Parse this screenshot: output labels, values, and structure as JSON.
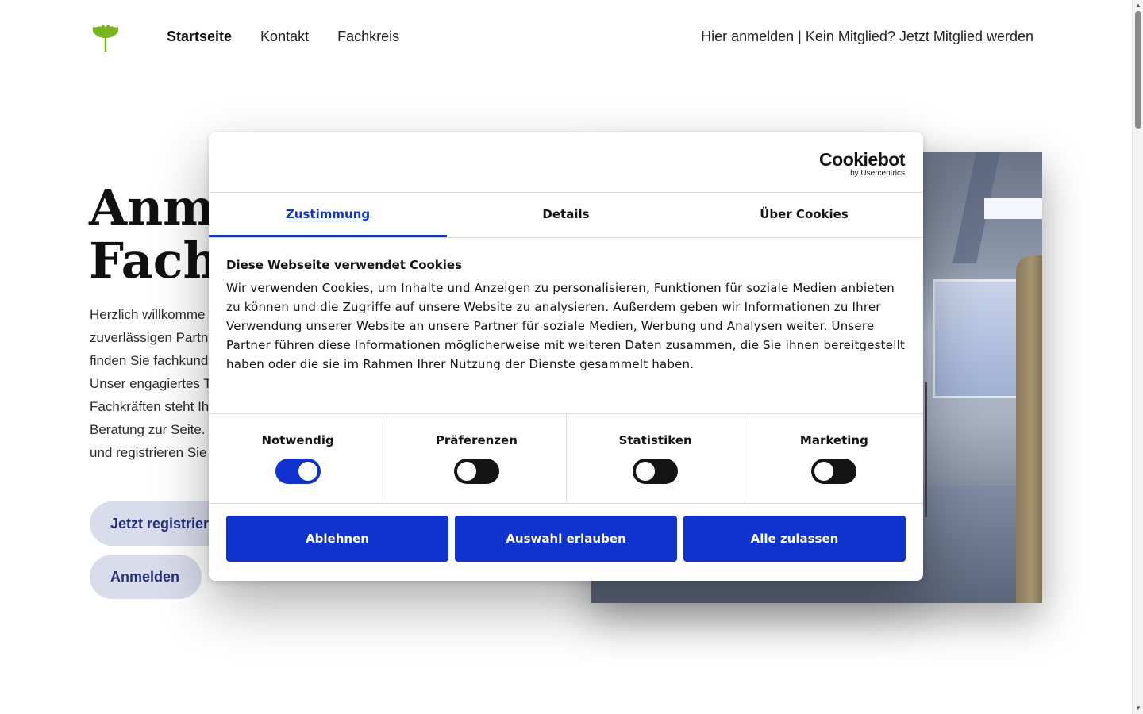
{
  "nav": {
    "items": [
      {
        "label": "Startseite",
        "active": true
      },
      {
        "label": "Kontakt",
        "active": false
      },
      {
        "label": "Fachkreis",
        "active": false
      }
    ],
    "auth": {
      "login": "Hier anmelden",
      "separator": " | ",
      "signup": "Kein Mitglied? Jetzt Mitglied werden"
    },
    "logo_icon": "ginkgo-leaf-icon",
    "logo_color": "#7ab51d"
  },
  "hero": {
    "title_line1": "Anme",
    "title_line2": "Fachk",
    "text_lines": [
      "Herzlich willkomme",
      "zuverlässigen Partn",
      "finden Sie fachkund",
      "Unser engagiertes T",
      "Fachkräften steht Ih",
      "Beratung zur Seite.",
      "und registrieren Sie"
    ],
    "register_button": "Jetzt registrier",
    "login_button": "Anmelden"
  },
  "cookie": {
    "brand": "Cookiebot",
    "brand_sub": "by Usercentrics",
    "tabs": [
      {
        "label": "Zustimmung",
        "active": true
      },
      {
        "label": "Details",
        "active": false
      },
      {
        "label": "Über Cookies",
        "active": false
      }
    ],
    "heading": "Diese Webseite verwendet Cookies",
    "body": "Wir verwenden Cookies, um Inhalte und Anzeigen zu personalisieren, Funktionen für soziale Medien anbieten zu können und die Zugriffe auf unsere Website zu analysieren. Außerdem geben wir Informationen zu Ihrer Verwendung unserer Website an unsere Partner für soziale Medien, Werbung und Analysen weiter. Unsere Partner führen diese Informationen möglicherweise mit weiteren Daten zusammen, die Sie ihnen bereitgestellt haben oder die sie im Rahmen Ihrer Nutzung der Dienste gesammelt haben.",
    "toggles": [
      {
        "label": "Notwendig",
        "on": true
      },
      {
        "label": "Präferenzen",
        "on": false
      },
      {
        "label": "Statistiken",
        "on": false
      },
      {
        "label": "Marketing",
        "on": false
      }
    ],
    "buttons": {
      "reject": "Ablehnen",
      "allow_selection": "Auswahl erlauben",
      "allow_all": "Alle zulassen"
    },
    "accent_color": "#1032cf"
  }
}
